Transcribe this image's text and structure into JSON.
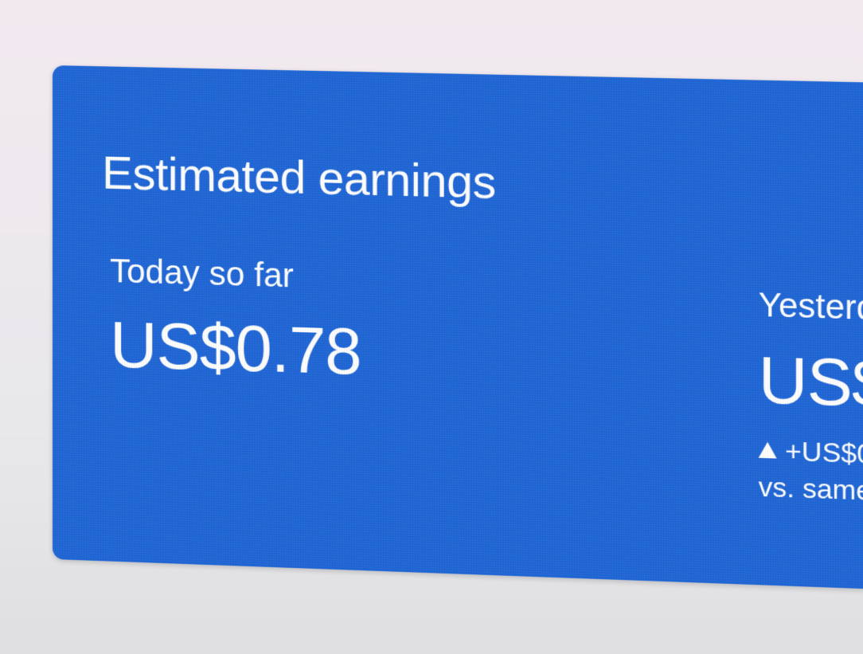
{
  "card": {
    "title": "Estimated earnings",
    "background_color": "#1f66d6"
  },
  "metrics": {
    "today": {
      "label": "Today so far",
      "value": "US$0.78"
    },
    "yesterday": {
      "label": "Yesterd",
      "value": "US$",
      "delta": "+US$0.",
      "delta_icon": "triangle-up-icon",
      "comparison": "vs. same"
    }
  }
}
